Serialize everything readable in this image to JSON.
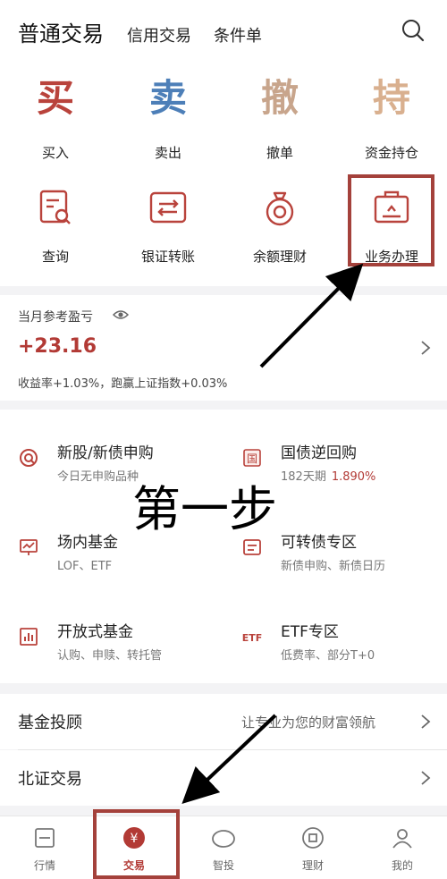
{
  "header": {
    "title": "普通交易",
    "tabs": [
      "信用交易",
      "条件单"
    ],
    "search_icon": "search-icon"
  },
  "actions": {
    "trade": [
      {
        "glyph": "买",
        "label": "买入",
        "color": "#b9433c"
      },
      {
        "glyph": "卖",
        "label": "卖出",
        "color": "#4d7fb8"
      },
      {
        "glyph": "撤",
        "label": "撤单",
        "color": "#c8a58c"
      },
      {
        "glyph": "持",
        "label": "资金持仓",
        "color": "#d9b08f"
      }
    ],
    "tools": [
      {
        "icon": "query-icon",
        "label": "查询"
      },
      {
        "icon": "transfer-icon",
        "label": "银证转账"
      },
      {
        "icon": "money-bag-icon",
        "label": "余额理财"
      },
      {
        "icon": "briefcase-icon",
        "label": "业务办理"
      }
    ]
  },
  "profit": {
    "label": "当月参考盈亏",
    "value": "+23.16",
    "summary": "收益率+1.03%，跑赢上证指数+0.03%"
  },
  "products": [
    {
      "name": "新股/新债申购",
      "desc": "今日无申购品种",
      "rate": "",
      "icon": "ipo-icon"
    },
    {
      "name": "国债逆回购",
      "desc": "182天期",
      "rate": "1.890%",
      "icon": "bond-repo-icon"
    },
    {
      "name": "场内基金",
      "desc": "LOF、ETF",
      "rate": "",
      "icon": "fund-chart-icon"
    },
    {
      "name": "可转债专区",
      "desc": "新债申购、新债日历",
      "rate": "",
      "icon": "convertible-bond-icon"
    },
    {
      "name": "开放式基金",
      "desc": "认购、申赎、转托管",
      "rate": "",
      "icon": "bar-chart-icon"
    },
    {
      "name": "ETF专区",
      "desc": "低费率、部分T+0",
      "rate": "",
      "icon": "etf-icon"
    }
  ],
  "annotation": "第一步",
  "rows": [
    {
      "title": "基金投顾",
      "subtitle": "让专业为您的财富领航"
    },
    {
      "title": "北证交易",
      "subtitle": ""
    }
  ],
  "nav": [
    {
      "label": "行情",
      "icon": "market-icon"
    },
    {
      "label": "交易",
      "icon": "yuan-icon"
    },
    {
      "label": "智投",
      "icon": "smart-invest-icon"
    },
    {
      "label": "理财",
      "icon": "wealth-icon"
    },
    {
      "label": "我的",
      "icon": "profile-icon"
    }
  ],
  "colors": {
    "accent": "#b23a35",
    "highlight": "#a4413b"
  }
}
